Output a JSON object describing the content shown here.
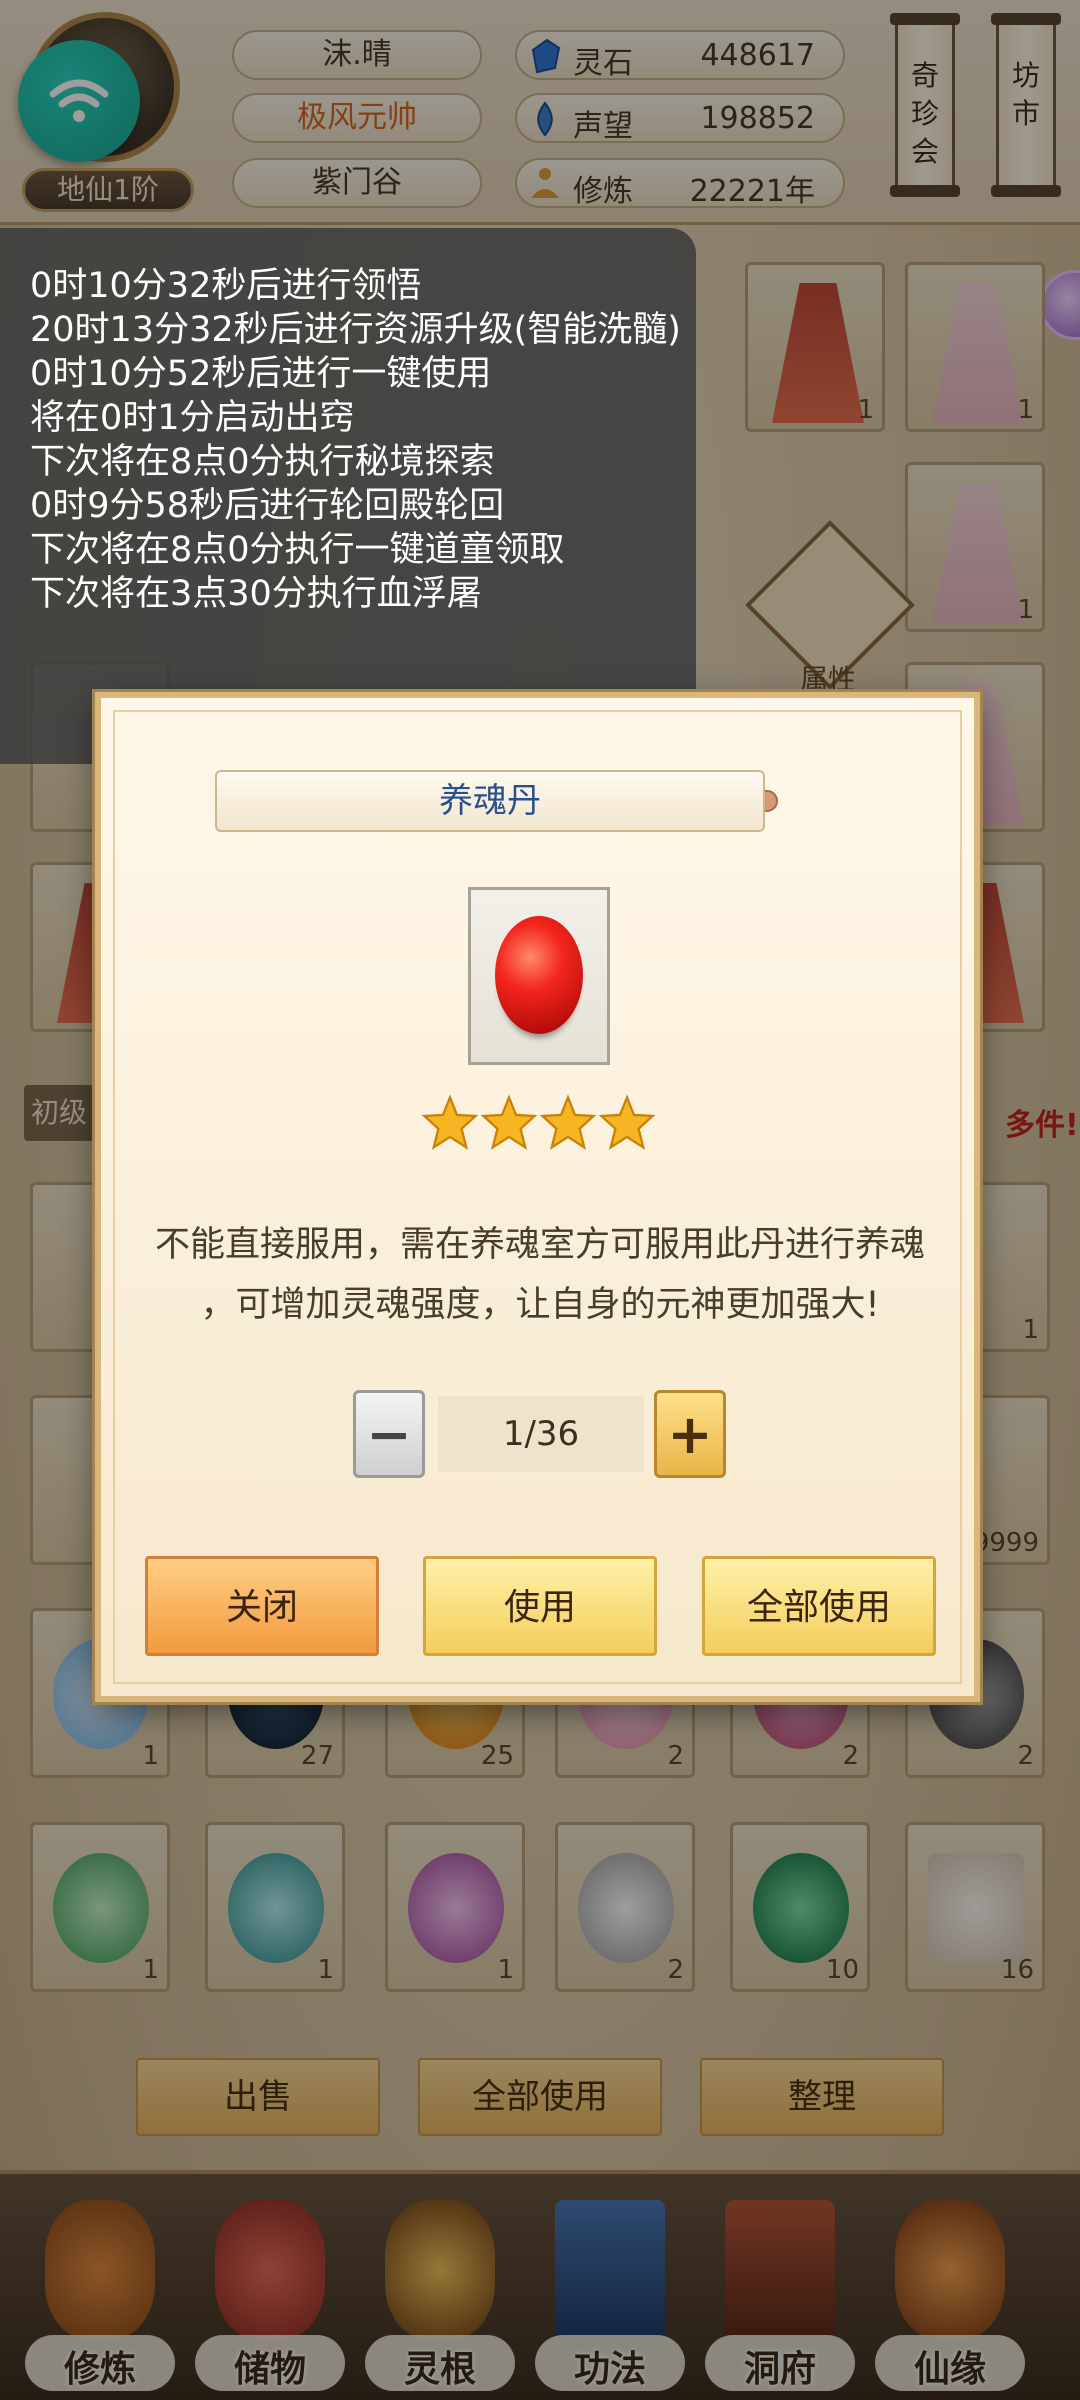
{
  "header": {
    "rank": "地仙1阶",
    "player_name": "沫.晴",
    "title": "极风元帅",
    "sect": "紫门谷",
    "resources": [
      {
        "icon": "spirit-stone-icon",
        "label": "灵石",
        "value": "448617"
      },
      {
        "icon": "reputation-icon",
        "label": "声望",
        "value": "198852"
      },
      {
        "icon": "cultivation-icon",
        "label": "修炼",
        "value": "22221年"
      }
    ],
    "banners": [
      "奇珍会",
      "坊市"
    ]
  },
  "task_log": {
    "lines": [
      "0时10分32秒后进行领悟",
      "20时13分32秒后进行资源升级(智能洗髓)",
      "0时10分52秒后进行一键使用",
      "将在0时1分启动出窍",
      "下次将在8点0分执行秘境探索",
      "0时9分58秒后进行轮回殿轮回",
      "下次将在8点0分执行一键道童领取",
      "下次将在3点30分执行血浮屠"
    ]
  },
  "inventory": {
    "tab_label": "初级",
    "gender_label": "属性",
    "many_items_text": "多件!",
    "counts_row_top": [
      "1",
      "1",
      "1"
    ],
    "counts_row_bottom1": [
      "1",
      "27",
      "25",
      "2",
      "2",
      "2"
    ],
    "counts_row_bottom2": [
      "1",
      "1",
      "1",
      "2",
      "10",
      "16"
    ],
    "right_count_a": "1",
    "right_count_b": "9999",
    "buttons": {
      "sell": "出售",
      "use_all": "全部使用",
      "sort": "整理"
    }
  },
  "modal": {
    "title": "养魂丹",
    "stars": 4,
    "description_line1": "不能直接服用，需在养魂室方可服用此丹进行养魂",
    "description_line2": "，可增加灵魂强度，让自身的元神更加强大!",
    "quantity": "1/36",
    "minus_symbol": "−",
    "plus_symbol": "+",
    "buttons": {
      "close": "关闭",
      "use": "使用",
      "use_all": "全部使用"
    }
  },
  "bottom_nav": [
    {
      "label": "修炼",
      "icon": "cultivate-icon"
    },
    {
      "label": "储物",
      "icon": "storage-bag-icon"
    },
    {
      "label": "灵根",
      "icon": "spirit-root-icon"
    },
    {
      "label": "功法",
      "icon": "technique-book-icon"
    },
    {
      "label": "洞府",
      "icon": "cave-dwelling-icon"
    },
    {
      "label": "仙缘",
      "icon": "immortal-fate-icon"
    }
  ]
}
